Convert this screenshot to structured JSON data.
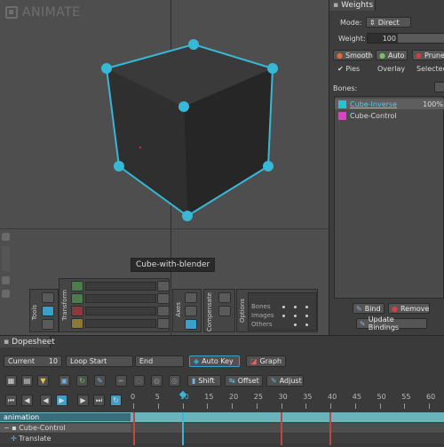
{
  "app": {
    "brand": "ANIMATE"
  },
  "viewport": {
    "tooltip": "Cube-with-blender"
  },
  "toolgroups": {
    "tools_label": "Tools",
    "transform_label": "Transform",
    "axes_label": "Axes",
    "compensate_label": "Compensate",
    "options_label": "Options"
  },
  "options": {
    "rows": [
      "Bones",
      "Images",
      "Others"
    ]
  },
  "weights": {
    "tab": "Weights",
    "mode_label": "Mode:",
    "mode_value": "Direct",
    "weight_label": "Weight:",
    "weight_value": "100",
    "smooth": "Smooth",
    "auto": "Auto",
    "prune": "Prune",
    "pies": "Pies",
    "overlay": "Overlay",
    "selected": "Selected",
    "bones_label": "Bones:",
    "bones": [
      {
        "name": "Cube-Inverse",
        "value": "100%",
        "color": "#27c3d4"
      },
      {
        "name": "Cube-Control",
        "value": "",
        "color": "#e23fc8"
      }
    ],
    "bind": "Bind",
    "remove": "Remove",
    "update": "Update Bindings"
  },
  "dopesheet": {
    "tab": "Dopesheet",
    "current_label": "Current",
    "current_value": "10",
    "loop_start": "Loop Start",
    "end": "End",
    "auto_key": "Auto Key",
    "graph": "Graph",
    "shift": "Shift",
    "offset": "Offset",
    "adjust": "Adjust",
    "ruler_ticks": [
      "0",
      "5",
      "10",
      "15",
      "20",
      "25",
      "30",
      "35",
      "40",
      "45",
      "50",
      "55",
      "60"
    ],
    "tracks": [
      "animation",
      "Cube-Control",
      "Translate"
    ]
  }
}
